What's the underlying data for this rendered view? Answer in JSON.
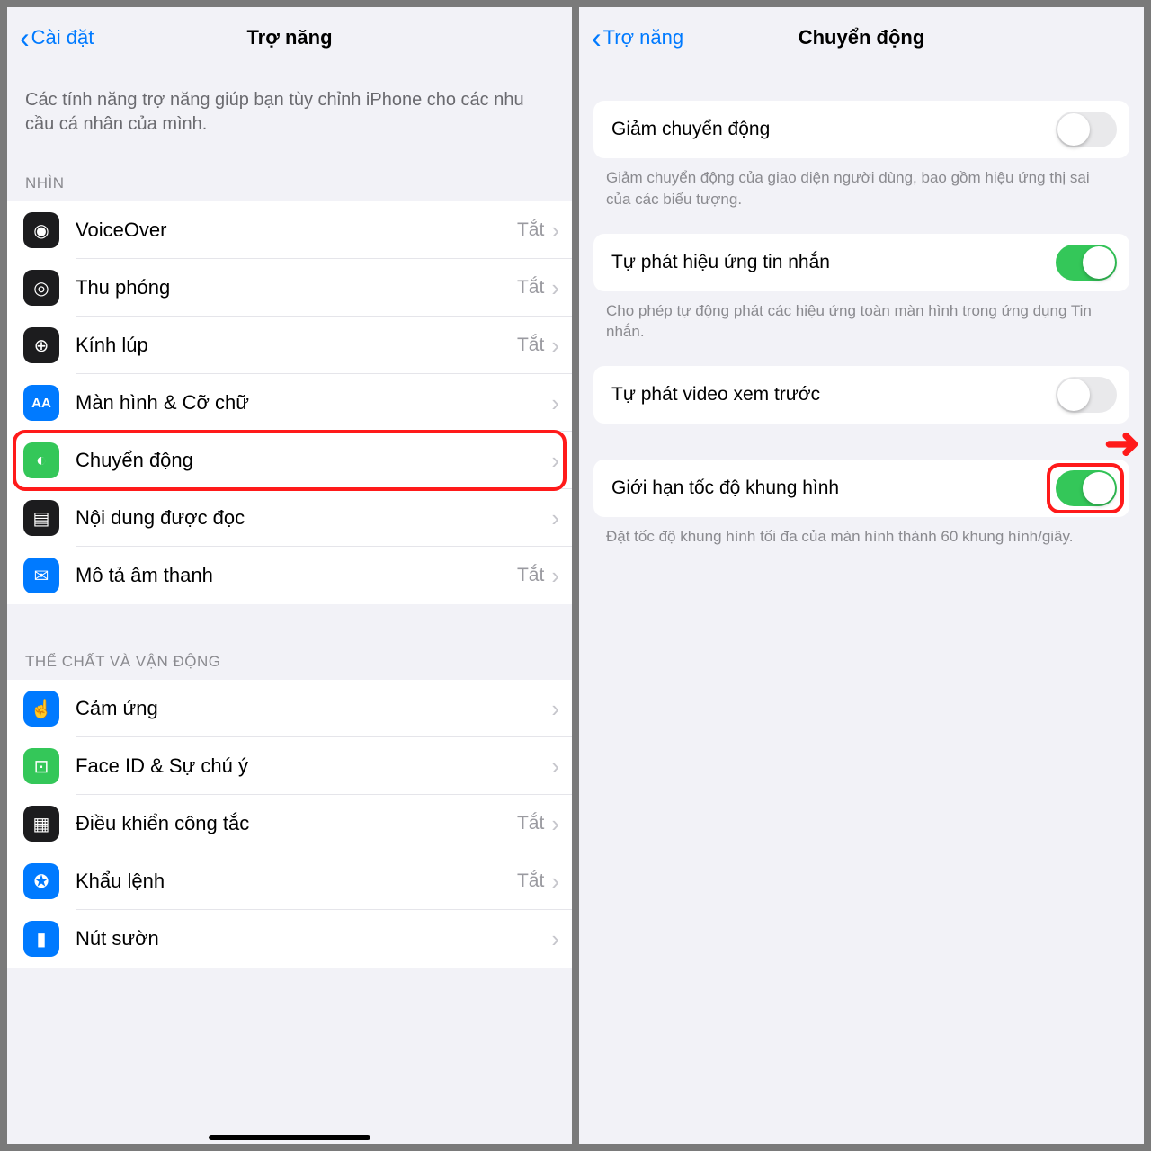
{
  "left": {
    "back": "Cài đặt",
    "title": "Trợ năng",
    "desc": "Các tính năng trợ năng giúp bạn tùy chỉnh iPhone cho các nhu cầu cá nhân của mình.",
    "section1_header": "NHÌN",
    "section1_items": [
      {
        "label": "VoiceOver",
        "status": "Tắt",
        "icon": "accessibility-icon",
        "bg": "#1c1c1e"
      },
      {
        "label": "Thu phóng",
        "status": "Tắt",
        "icon": "zoom-scope-icon",
        "bg": "#1c1c1e"
      },
      {
        "label": "Kính lúp",
        "status": "Tắt",
        "icon": "magnifier-icon",
        "bg": "#1c1c1e"
      },
      {
        "label": "Màn hình & Cỡ chữ",
        "status": "",
        "icon": "text-size-icon",
        "bg": "#007aff"
      },
      {
        "label": "Chuyển động",
        "status": "",
        "icon": "motion-icon",
        "bg": "#34c759",
        "highlight": true
      },
      {
        "label": "Nội dung được đọc",
        "status": "",
        "icon": "speech-bubble-icon",
        "bg": "#1c1c1e"
      },
      {
        "label": "Mô tả âm thanh",
        "status": "Tắt",
        "icon": "audio-desc-icon",
        "bg": "#007aff"
      }
    ],
    "section2_header": "THỂ CHẤT VÀ VẬN ĐỘNG",
    "section2_items": [
      {
        "label": "Cảm ứng",
        "status": "",
        "icon": "touch-icon",
        "bg": "#007aff"
      },
      {
        "label": "Face ID & Sự chú ý",
        "status": "",
        "icon": "faceid-icon",
        "bg": "#34c759"
      },
      {
        "label": "Điều khiển công tắc",
        "status": "Tắt",
        "icon": "switch-control-icon",
        "bg": "#1c1c1e"
      },
      {
        "label": "Khẩu lệnh",
        "status": "Tắt",
        "icon": "voice-control-icon",
        "bg": "#007aff"
      },
      {
        "label": "Nút sườn",
        "status": "",
        "icon": "side-button-icon",
        "bg": "#007aff"
      }
    ]
  },
  "right": {
    "back": "Trợ năng",
    "title": "Chuyển động",
    "items": [
      {
        "label": "Giảm chuyển động",
        "on": false,
        "foot": "Giảm chuyển động của giao diện người dùng, bao gồm hiệu ứng thị sai của các biểu tượng."
      },
      {
        "label": "Tự phát hiệu ứng tin nhắn",
        "on": true,
        "foot": "Cho phép tự động phát các hiệu ứng toàn màn hình trong ứng dụng Tin nhắn."
      },
      {
        "label": "Tự phát video xem trước",
        "on": false,
        "foot": ""
      },
      {
        "label": "Giới hạn tốc độ khung hình",
        "on": true,
        "foot": "Đặt tốc độ khung hình tối đa của màn hình thành 60 khung hình/giây.",
        "highlight": true
      }
    ]
  }
}
